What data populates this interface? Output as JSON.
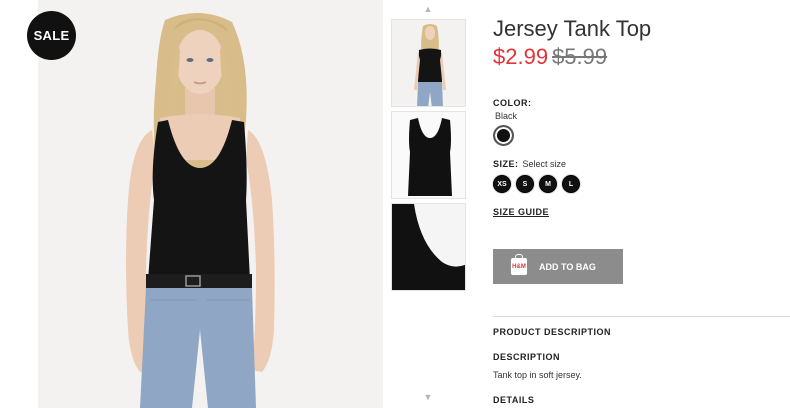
{
  "badge": {
    "text": "SALE"
  },
  "product": {
    "title": "Jersey Tank Top",
    "price_sale": "$2.99",
    "price_original": "$5.99"
  },
  "color": {
    "label": "COLOR:",
    "value": "Black",
    "swatch_hex": "#111111"
  },
  "size": {
    "label": "SIZE:",
    "prompt": "Select size",
    "options": [
      "XS",
      "S",
      "M",
      "L"
    ]
  },
  "size_guide": "SIZE GUIDE",
  "add_to_bag": {
    "label": "ADD TO BAG",
    "icon_text": "H&M"
  },
  "description": {
    "product_description_heading": "PRODUCT DESCRIPTION",
    "description_heading": "DESCRIPTION",
    "description_text": "Tank top in soft jersey.",
    "details_heading": "DETAILS"
  },
  "thumbnails": [
    "model-front",
    "tank-top-flat",
    "tank-top-detail"
  ],
  "colors": {
    "sale_price": "#e2323a",
    "button_bg": "#8c8c8c",
    "badge_bg": "#111111"
  }
}
